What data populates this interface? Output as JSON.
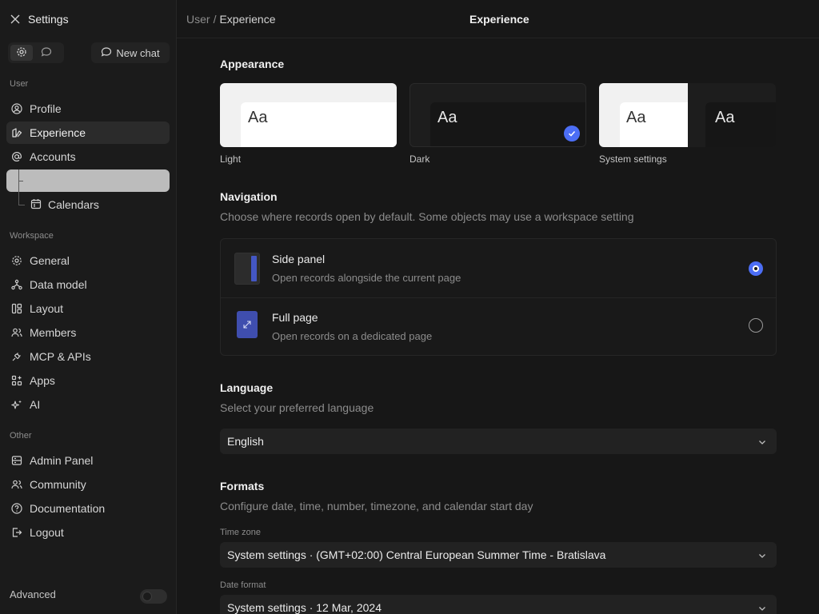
{
  "sidebar": {
    "title": "Settings",
    "new_chat": "New chat",
    "sections": {
      "user": "User",
      "workspace": "Workspace",
      "other": "Other"
    },
    "user_items": [
      "Profile",
      "Experience",
      "Accounts"
    ],
    "highlighted_item": "",
    "sub_item": "Calendars",
    "workspace_items": [
      "General",
      "Data model",
      "Layout",
      "Members",
      "MCP & APIs",
      "Apps",
      "AI"
    ],
    "other_items": [
      "Admin Panel",
      "Community",
      "Documentation",
      "Logout"
    ],
    "advanced_label": "Advanced",
    "advanced_on": false
  },
  "header": {
    "breadcrumb_parent": "User",
    "breadcrumb_sep": "/",
    "breadcrumb_current": "Experience",
    "title": "Experience"
  },
  "appearance": {
    "heading": "Appearance",
    "preview_text": "Aa",
    "options": [
      "Light",
      "Dark",
      "System settings"
    ],
    "selected": "Dark",
    "accent": "#4c6ef5"
  },
  "navigation": {
    "heading": "Navigation",
    "description": "Choose where records open by default. Some objects may use a workspace setting",
    "options": [
      {
        "title": "Side panel",
        "subtitle": "Open records alongside the current page"
      },
      {
        "title": "Full page",
        "subtitle": "Open records on a dedicated page"
      }
    ],
    "selected": "Side panel"
  },
  "language": {
    "heading": "Language",
    "description": "Select your preferred language",
    "value": "English"
  },
  "formats": {
    "heading": "Formats",
    "description": "Configure date, time, number, timezone, and calendar start day",
    "time_zone_label": "Time zone",
    "time_zone_value": "System settings · (GMT+02:00) Central European Summer Time - Bratislava",
    "date_format_label": "Date format",
    "date_format_value": "System settings · 12 Mar, 2024"
  }
}
